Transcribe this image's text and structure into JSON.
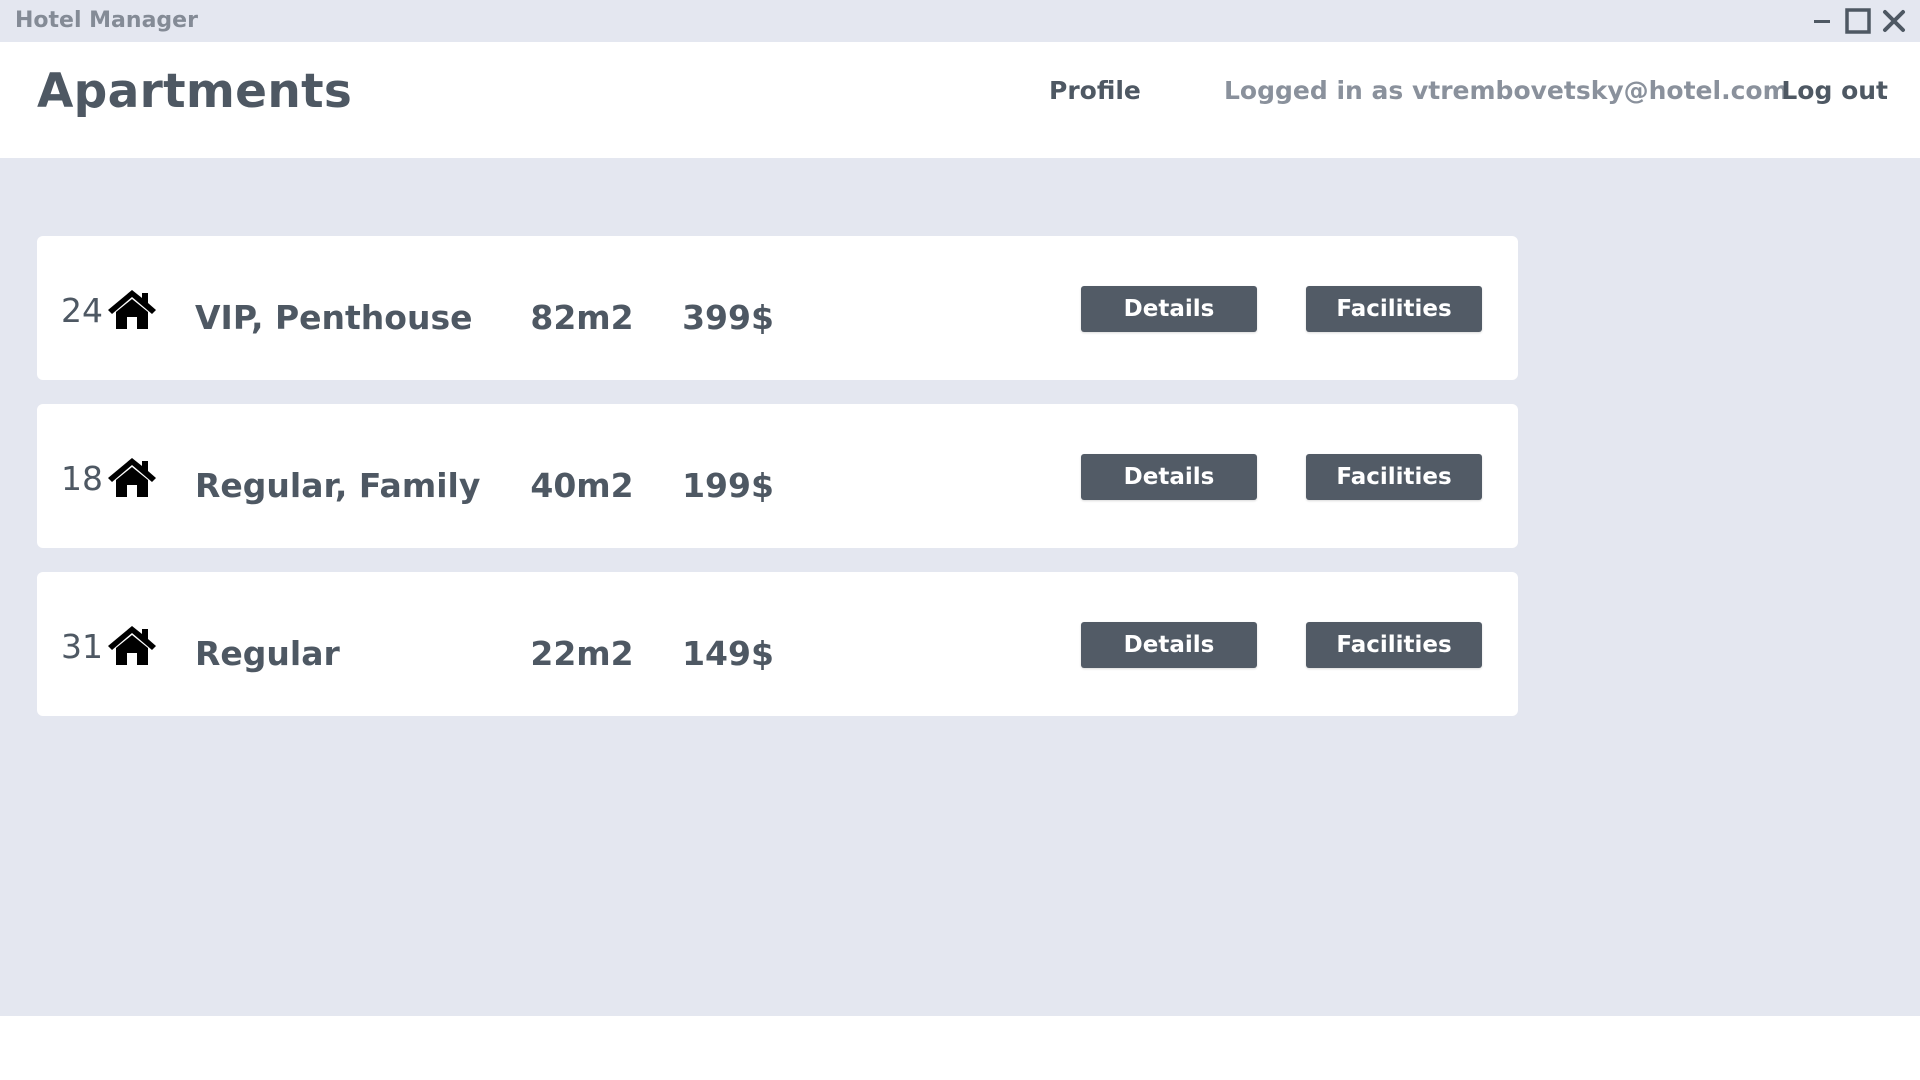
{
  "window": {
    "title": "Hotel Manager",
    "controls": [
      "minimize-icon",
      "maximize-icon",
      "close-icon"
    ]
  },
  "header": {
    "title": "Apartments",
    "profile_label": "Profile",
    "logged_in_text": "Logged in as vtrembovetsky@hotel.com",
    "logout_label": "Log out"
  },
  "apartments": [
    {
      "number": "24",
      "icon": "home-icon",
      "type": "VIP, Penthouse",
      "area": "82m2",
      "price": "399$",
      "details_label": "Details",
      "facilities_label": "Facilities"
    },
    {
      "number": "18",
      "icon": "home-icon",
      "type": "Regular, Family",
      "area": "40m2",
      "price": "199$",
      "details_label": "Details",
      "facilities_label": "Facilities"
    },
    {
      "number": "31",
      "icon": "home-icon",
      "type": "Regular",
      "area": "22m2",
      "price": "149$",
      "details_label": "Details",
      "facilities_label": "Facilities"
    }
  ],
  "colors": {
    "background": "#e4e7f0",
    "card": "#ffffff",
    "button": "#525b66",
    "text": "#4e5863",
    "muted_text": "#8a919c"
  }
}
